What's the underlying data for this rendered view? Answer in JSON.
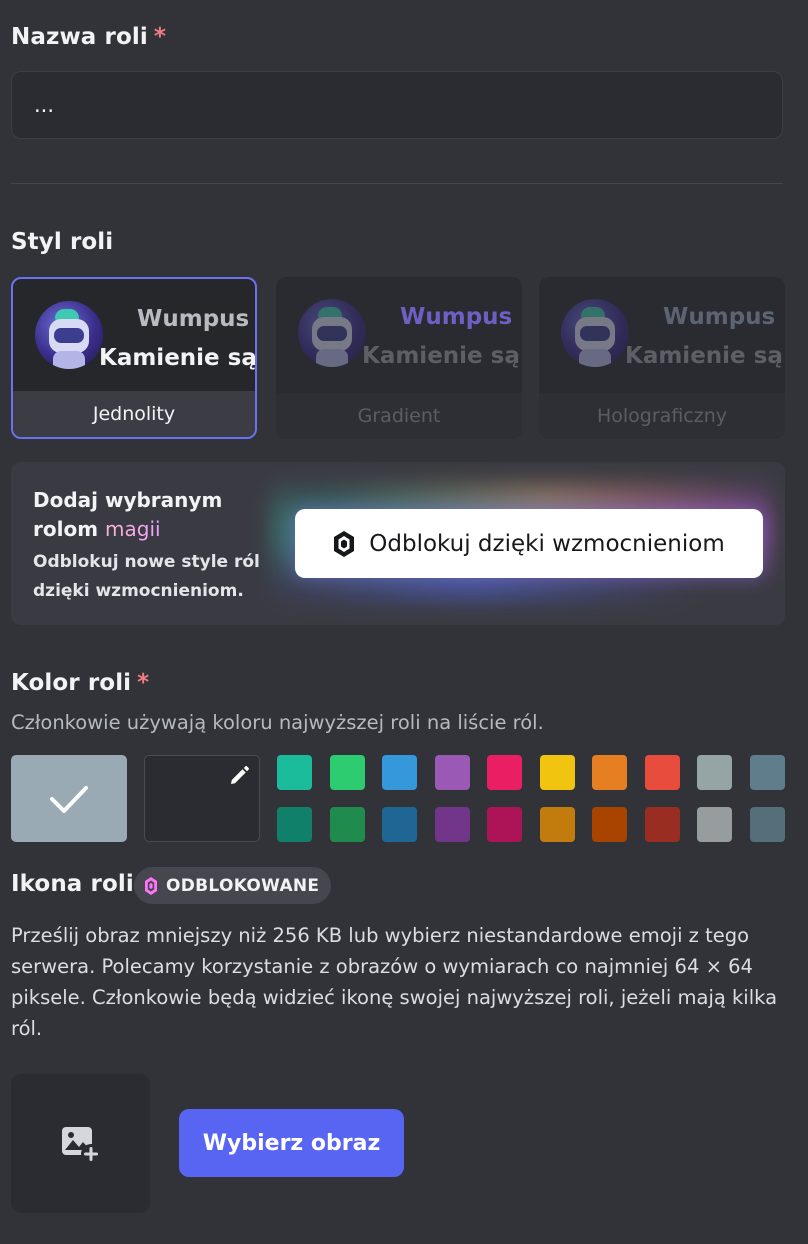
{
  "role_name": {
    "label": "Nazwa roli",
    "required_mark": "*",
    "value": "..."
  },
  "role_style": {
    "label": "Styl roli",
    "preview_username": "Wumpus",
    "preview_message": "Kamienie są ba",
    "options": [
      {
        "label": "Jednolity",
        "selected": true,
        "name_color": "#b9bbc3"
      },
      {
        "label": "Gradient",
        "selected": false,
        "name_color": "#6e5fc4"
      },
      {
        "label": "Holograficzny",
        "selected": false,
        "name_color": "#5c6373"
      }
    ]
  },
  "boost_panel": {
    "title_prefix": "Dodaj wybranym rolom",
    "title_highlight": "magii",
    "description": "Odblokuj nowe style ról dzięki wzmocnieniom.",
    "button_label": "Odblokuj dzięki wzmocnieniom",
    "button_icon": "nitro-gem-icon"
  },
  "role_color": {
    "label": "Kolor roli",
    "required_mark": "*",
    "hint": "Członkowie używają koloru najwyższej roli na liście ról.",
    "default_swatch": "#99aab5",
    "custom_swatch": "#2b2c31",
    "selected": "default",
    "swatches_top": [
      "#1abc9c",
      "#2ecc71",
      "#3498db",
      "#9b59b6",
      "#e91e63",
      "#f1c40f",
      "#e67e22",
      "#e74c3c",
      "#95a5a6",
      "#607d8b"
    ],
    "swatches_bottom": [
      "#11806a",
      "#1f8b4c",
      "#206694",
      "#71368a",
      "#ad1457",
      "#c27c0e",
      "#a84300",
      "#992d22",
      "#979c9f",
      "#546e7a"
    ]
  },
  "role_icon": {
    "label": "Ikona roli",
    "badge": "ODBLOKOWANE",
    "description": "Prześlij obraz mniejszy niż 256 KB lub wybierz niestandardowe emoji z tego serwera. Polecamy korzystanie z obrazów o wymiarach co najmniej 64 × 64 piksele. Członkowie będą widzieć ikonę swojej najwyższej roli, jeżeli mają kilka ról.",
    "choose_button": "Wybierz obraz"
  }
}
